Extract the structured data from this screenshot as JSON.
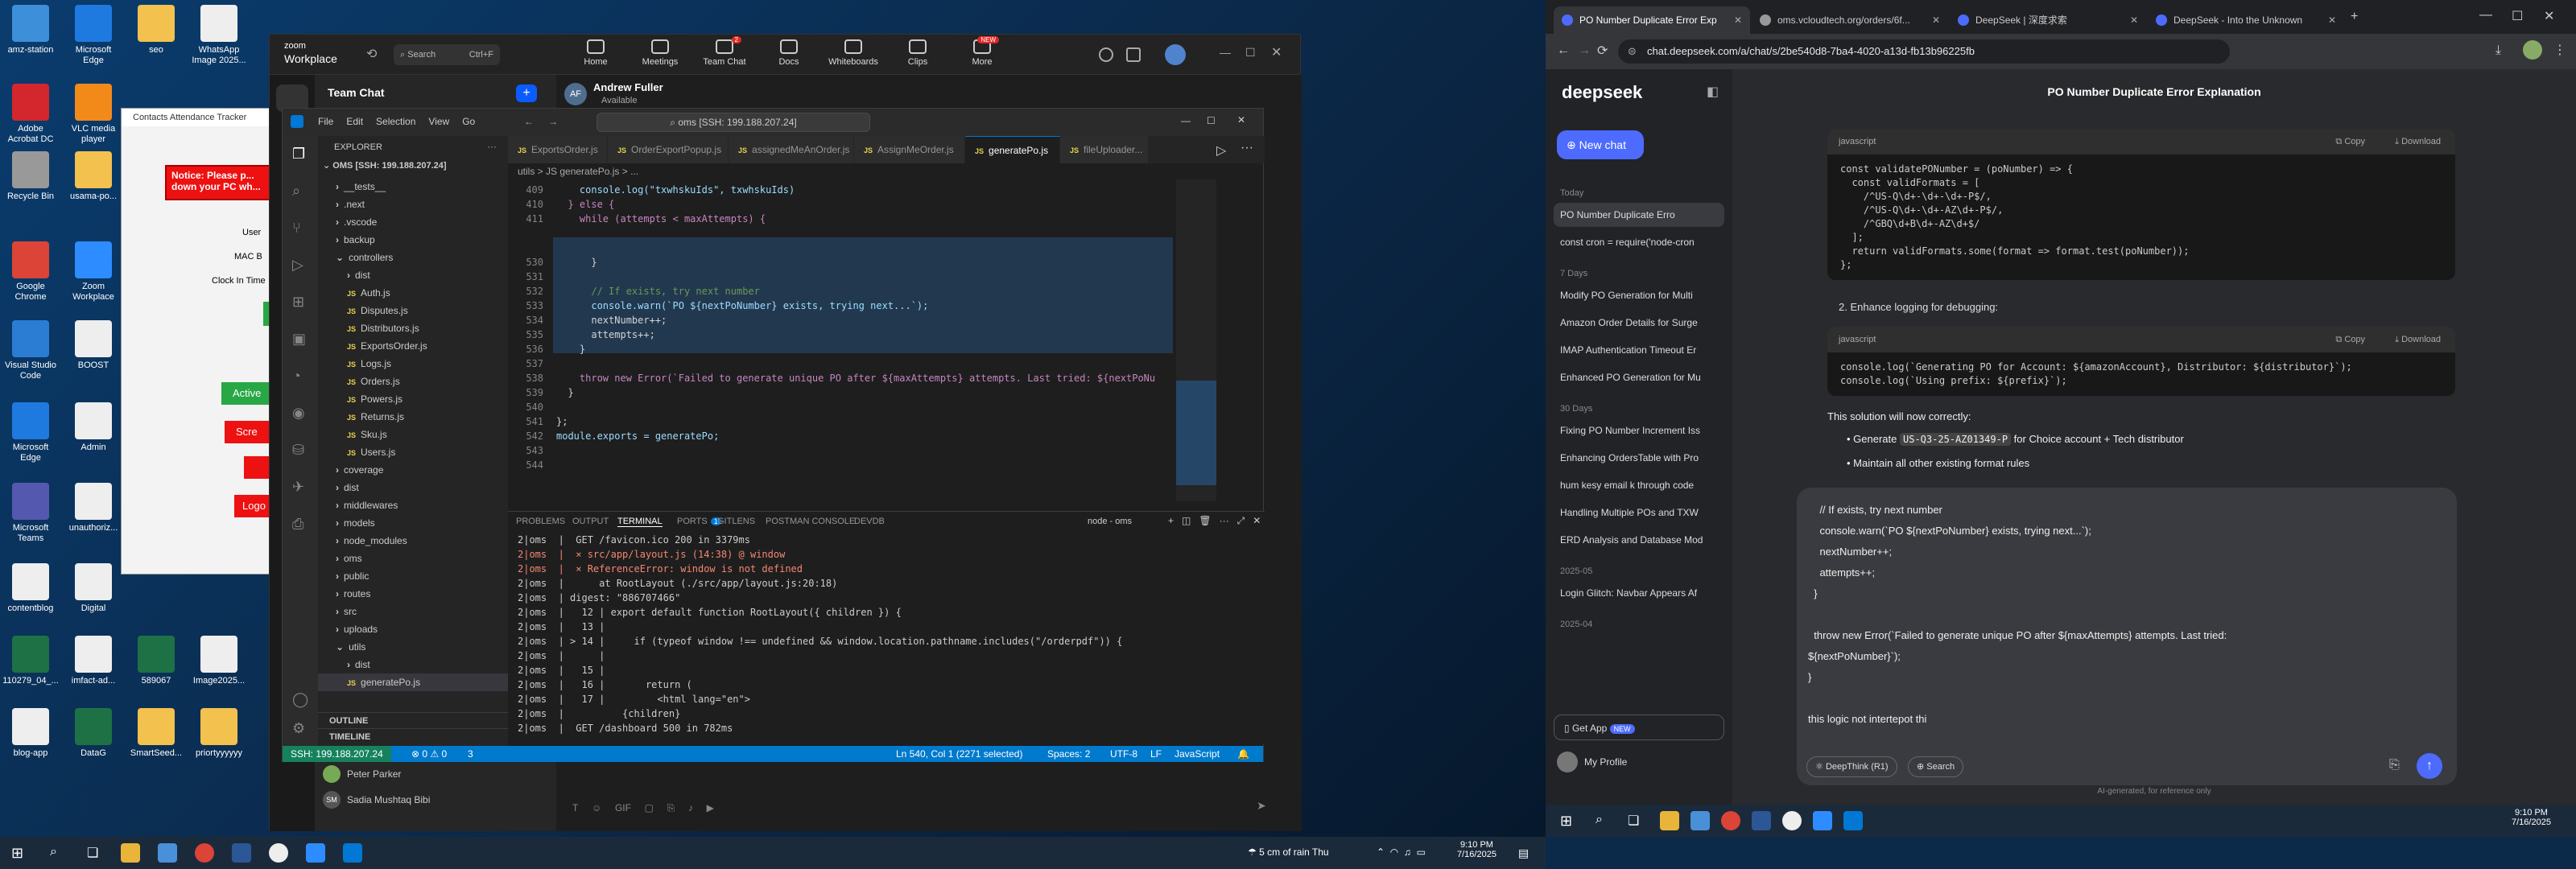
{
  "desktop": {
    "icons": [
      {
        "label": "amz-station"
      },
      {
        "label": "Microsoft Edge"
      },
      {
        "label": "seo"
      },
      {
        "label": "WhatsApp Image 2025..."
      },
      {
        "label": "Adobe Acrobat DC"
      },
      {
        "label": "VLC media player"
      },
      {
        "label": "Recycle Bin"
      },
      {
        "label": "usama-po..."
      },
      {
        "label": "Google Chrome"
      },
      {
        "label": "Zoom Workplace"
      },
      {
        "label": "Visual Studio Code"
      },
      {
        "label": "BOOST"
      },
      {
        "label": "Microsoft Edge"
      },
      {
        "label": "Admin"
      },
      {
        "label": "Microsoft Teams"
      },
      {
        "label": "unauthoriz..."
      },
      {
        "label": "contentblog"
      },
      {
        "label": "Digital"
      },
      {
        "label": "110279_04_..."
      },
      {
        "label": "imfact-ad..."
      },
      {
        "label": "589067"
      },
      {
        "label": "Image2025..."
      },
      {
        "label": "blog-app"
      },
      {
        "label": "DataG"
      },
      {
        "label": "SmartSeed..."
      },
      {
        "label": "priortyyyyyy"
      }
    ],
    "attendance": {
      "title": "Contacts Attendance Tracker",
      "notice": "Notice: Please p... down your PC wh...",
      "clock_in": "Clock In Time",
      "active": "Active",
      "screen": "Scre",
      "logout": "Logo",
      "mac": "MAC B",
      "user": "User"
    }
  },
  "zoom": {
    "brand": "zoom",
    "product": "Workplace",
    "search": "Search",
    "shortcut": "Ctrl+F",
    "nav": [
      {
        "label": "Home"
      },
      {
        "label": "Meetings"
      },
      {
        "label": "Team Chat",
        "badge": "2"
      },
      {
        "label": "Docs"
      },
      {
        "label": "Whiteboards"
      },
      {
        "label": "Clips"
      },
      {
        "label": "More",
        "badge": "NEW"
      }
    ],
    "team_chat_title": "Team Chat",
    "contact_name": "Andrew Fuller",
    "contact_status": "Available",
    "contact_initials": "AF",
    "people": [
      {
        "name": "Peter Parker"
      },
      {
        "name": "Sadia Mushtaq Bibi",
        "initials": "SM"
      }
    ],
    "composer_tools": [
      "GIF"
    ]
  },
  "vscode": {
    "menu": [
      "File",
      "Edit",
      "Selection",
      "View",
      "Go"
    ],
    "search": "oms [SSH: 199.188.207.24]",
    "explorer_title": "EXPLORER",
    "root": "OMS [SSH: 199.188.207.24]",
    "tree": [
      {
        "label": "__tests__",
        "indent": 1,
        "type": "folder"
      },
      {
        "label": ".next",
        "indent": 1,
        "type": "folder"
      },
      {
        "label": ".vscode",
        "indent": 1,
        "type": "folder"
      },
      {
        "label": "backup",
        "indent": 1,
        "type": "folder"
      },
      {
        "label": "controllers",
        "indent": 1,
        "type": "folder-open"
      },
      {
        "label": "dist",
        "indent": 2,
        "type": "folder"
      },
      {
        "label": "Auth.js",
        "indent": 2,
        "type": "js"
      },
      {
        "label": "Disputes.js",
        "indent": 2,
        "type": "js"
      },
      {
        "label": "Distributors.js",
        "indent": 2,
        "type": "js"
      },
      {
        "label": "ExportsOrder.js",
        "indent": 2,
        "type": "js"
      },
      {
        "label": "Logs.js",
        "indent": 2,
        "type": "js"
      },
      {
        "label": "Orders.js",
        "indent": 2,
        "type": "js"
      },
      {
        "label": "Powers.js",
        "indent": 2,
        "type": "js"
      },
      {
        "label": "Returns.js",
        "indent": 2,
        "type": "js"
      },
      {
        "label": "Sku.js",
        "indent": 2,
        "type": "js"
      },
      {
        "label": "Users.js",
        "indent": 2,
        "type": "js"
      },
      {
        "label": "coverage",
        "indent": 1,
        "type": "folder"
      },
      {
        "label": "dist",
        "indent": 1,
        "type": "folder"
      },
      {
        "label": "middlewares",
        "indent": 1,
        "type": "folder"
      },
      {
        "label": "models",
        "indent": 1,
        "type": "folder"
      },
      {
        "label": "node_modules",
        "indent": 1,
        "type": "folder"
      },
      {
        "label": "oms",
        "indent": 1,
        "type": "folder"
      },
      {
        "label": "public",
        "indent": 1,
        "type": "folder"
      },
      {
        "label": "routes",
        "indent": 1,
        "type": "folder"
      },
      {
        "label": "src",
        "indent": 1,
        "type": "folder"
      },
      {
        "label": "uploads",
        "indent": 1,
        "type": "folder"
      },
      {
        "label": "utils",
        "indent": 1,
        "type": "folder-open"
      },
      {
        "label": "dist",
        "indent": 2,
        "type": "folder"
      },
      {
        "label": "generatePo.js",
        "indent": 2,
        "type": "js",
        "selected": true
      }
    ],
    "outline": "OUTLINE",
    "timeline": "TIMELINE",
    "tabs": [
      {
        "label": "ExportsOrder.js"
      },
      {
        "label": "OrderExportPopup.js"
      },
      {
        "label": "assignedMeAnOrder.js"
      },
      {
        "label": "AssignMeOrder.js"
      },
      {
        "label": "generatePo.js",
        "active": true
      },
      {
        "label": "fileUploader..."
      }
    ],
    "breadcrumb": "utils > JS generatePo.js > ...",
    "code": [
      {
        "n": "409",
        "t": "    console.log(\"txwhskuIds\", txwhskuIds)"
      },
      {
        "n": "410",
        "t": "  } else {"
      },
      {
        "n": "411",
        "t": "    while (attempts < maxAttempts) {"
      },
      {
        "n": "530",
        "t": "      }"
      },
      {
        "n": "531",
        "t": ""
      },
      {
        "n": "532",
        "t": "      // If exists, try next number"
      },
      {
        "n": "533",
        "t": "      console.warn(`PO ${nextPoNumber} exists, trying next...`);"
      },
      {
        "n": "534",
        "t": "      nextNumber++;"
      },
      {
        "n": "535",
        "t": "      attempts++;"
      },
      {
        "n": "536",
        "t": "    }"
      },
      {
        "n": "537",
        "t": ""
      },
      {
        "n": "538",
        "t": "    throw new Error(`Failed to generate unique PO after ${maxAttempts} attempts. Last tried: ${nextPoNu"
      },
      {
        "n": "539",
        "t": "  }"
      },
      {
        "n": "540",
        "t": ""
      },
      {
        "n": "541",
        "t": "};"
      },
      {
        "n": "542",
        "t": "module.exports = generatePo;"
      },
      {
        "n": "543",
        "t": ""
      },
      {
        "n": "544",
        "t": ""
      }
    ],
    "panel_tabs": [
      "PROBLEMS",
      "OUTPUT",
      "TERMINAL",
      "PORTS",
      "GITLENS",
      "POSTMAN CONSOLE",
      "DEVDB"
    ],
    "ports_badge": "1",
    "terminal_name": "node - oms",
    "terminal": [
      "2|oms  |  GET /favicon.ico 200 in 3379ms",
      "2|oms  |  ⨯ src/app/layout.js (14:38) @ window",
      "2|oms  |  ⨯ ReferenceError: window is not defined",
      "2|oms  |      at RootLayout (./src/app/layout.js:20:18)",
      "2|oms  | digest: \"886707466\"",
      "2|oms  |   12 | export default function RootLayout({ children }) {",
      "2|oms  |   13 |",
      "2|oms  | > 14 |     if (typeof window !== undefined && window.location.pathname.includes(\"/orderpdf\")) {",
      "2|oms  |      |",
      "2|oms  |   15 |",
      "2|oms  |   16 |       return (",
      "2|oms  |   17 |         <html lang=\"en\">",
      "2|oms  |          {children}",
      "2|oms  |  GET /dashboard 500 in 782ms"
    ],
    "status_left": "SSH: 199.188.207.24",
    "status_counts": "⊗ 0 ⚠ 0",
    "status_ports": "3",
    "status_pos": "Ln 540, Col 1 (2271 selected)",
    "status_spaces": "Spaces: 2",
    "status_enc": "UTF-8",
    "status_eol": "LF",
    "status_lang": "JavaScript"
  },
  "chrome": {
    "tabs": [
      {
        "label": "PO Number Duplicate Error Exp",
        "active": true
      },
      {
        "label": "oms.vcloudtech.org/orders/6f..."
      },
      {
        "label": "DeepSeek | 深度求索"
      },
      {
        "label": "DeepSeek - Into the Unknown"
      }
    ],
    "url": "chat.deepseek.com/a/chat/s/2be540d8-7ba4-4020-a13d-fb13b96225fb"
  },
  "deepseek": {
    "logo": "deepseek",
    "new_chat": "New chat",
    "groups": [
      {
        "label": "Today",
        "items": [
          "PO Number Duplicate Erro",
          "const cron = require('node-cron"
        ]
      },
      {
        "label": "7 Days",
        "items": [
          "Modify PO Generation for Multi",
          "Amazon Order Details for Surge",
          "IMAP Authentication Timeout Er",
          "Enhanced PO Generation for Mu"
        ]
      },
      {
        "label": "30 Days",
        "items": [
          "Fixing PO Number Increment Iss",
          "Enhancing OrdersTable with Pro",
          "hum kesy email k through code",
          "Handling Multiple POs and TXW",
          "ERD Analysis and Database Mod"
        ]
      },
      {
        "label": "2025-05",
        "items": [
          "Login Glitch: Navbar Appears Af"
        ]
      },
      {
        "label": "2025-04",
        "items": []
      }
    ],
    "get_app": "Get App",
    "get_app_badge": "NEW",
    "profile": "My Profile",
    "title": "PO Number Duplicate Error Explanation",
    "code_lang": "javascript",
    "copy": "Copy",
    "download": "Download",
    "code1": [
      "const validatePONumber = (poNumber) => {",
      "  const validFormats = [",
      "    /^US-Q\\d+-\\d+-\\d+-P$/,",
      "    /^US-Q\\d+-\\d+-AZ\\d+-P$/,",
      "    /^GBQ\\d+B\\d+-AZ\\d+$/",
      "  ];",
      "  return validFormats.some(format => format.test(poNumber));",
      "};"
    ],
    "step2": "2.  Enhance logging for debugging:",
    "code2": [
      "console.log(`Generating PO for Account: ${amazonAccount}, Distributor: ${distributor}`);",
      "console.log(`Using prefix: ${prefix}`);"
    ],
    "solution_intro": "This solution will now correctly:",
    "bullets": [
      {
        "pre": "Generate ",
        "code": "US-Q3-25-AZ01349-P",
        "post": " for Choice account + Tech distributor"
      },
      {
        "pre": "Maintain all other existing format rules",
        "code": "",
        "post": ""
      }
    ],
    "input_lines": [
      "    // If exists, try next number",
      "    console.warn(`PO ${nextPoNumber} exists, trying next...`);",
      "    nextNumber++;",
      "    attempts++;",
      "  }",
      "",
      "  throw new Error(`Failed to generate unique PO after ${maxAttempts} attempts. Last tried:",
      "${nextPoNumber}`);",
      "}",
      "",
      "this logic not intertepot thi"
    ],
    "deepthink": "DeepThink (R1)",
    "search": "Search",
    "footer": "AI-generated, for reference only"
  },
  "taskbar": {
    "weather": "5 cm of rain Thu",
    "time_left": "9:10 PM",
    "date_left": "7/16/2025",
    "time_right": "9:10 PM",
    "date_right": "7/16/2025"
  },
  "colors": {
    "vscode_status": "#007acc",
    "deepseek_accent": "#4d6bfe",
    "zoom_accent": "#0b5cff"
  }
}
